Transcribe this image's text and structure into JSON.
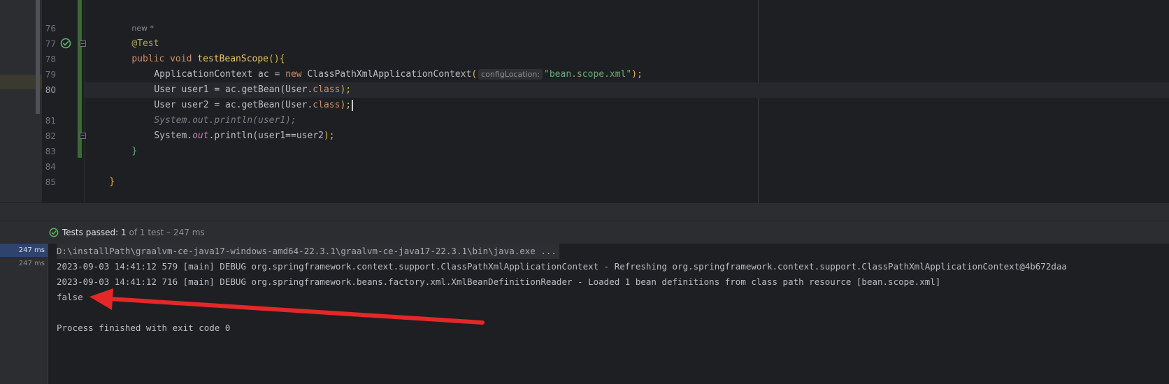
{
  "editor": {
    "usage_hint": "new *",
    "lines": [
      {
        "number": "76"
      },
      {
        "number": "77"
      },
      {
        "number": "78"
      },
      {
        "number": "79"
      },
      {
        "number": "80"
      },
      {
        "number": ""
      },
      {
        "number": "81"
      },
      {
        "number": "82"
      },
      {
        "number": "83"
      },
      {
        "number": "84"
      },
      {
        "number": "85"
      }
    ],
    "code": {
      "annotation": "@Test",
      "kw_public": "public",
      "kw_void": "void",
      "method_name": "testBeanScope",
      "method_parens": "()",
      "open_brace": "{",
      "line78_type": "ApplicationContext ac = ",
      "kw_new": "new",
      "line78_class": " ClassPathXmlApplicationContext",
      "open_paren": "(",
      "param_hint": "configLocation:",
      "string_literal": "\"bean.scope.xml\"",
      "close_paren_semi": ");",
      "line79_a": "User user1 = ac.getBean(",
      "line79_type": "User.",
      "kw_class": "class",
      "line79_close": ");",
      "line80_a": "User user2 = ac.getBean(",
      "line80_type": "User.",
      "kw_class2": "class",
      "line80_close": ");",
      "commented_line": "System.out.println(user1);",
      "line81_a": "System.",
      "line81_field": "out",
      "line81_b": ".println(",
      "line81_args": "user1==user2",
      "line81_close": ");",
      "close_brace_method": "}",
      "close_brace_class": "}"
    }
  },
  "run_panel": {
    "status_label": "Tests passed: ",
    "status_count": "1",
    "status_rest": " of 1 test – 247 ms",
    "tree_times": [
      "247 ms",
      "247 ms"
    ],
    "console_lines": [
      "D:\\installPath\\graalvm-ce-java17-windows-amd64-22.3.1\\graalvm-ce-java17-22.3.1\\bin\\java.exe ...",
      "2023-09-03 14:41:12 579 [main] DEBUG org.springframework.context.support.ClassPathXmlApplicationContext - Refreshing org.springframework.context.support.ClassPathXmlApplicationContext@4b672daa",
      "2023-09-03 14:41:12 716 [main] DEBUG org.springframework.beans.factory.xml.XmlBeanDefinitionReader - Loaded 1 bean definitions from class path resource [bean.scope.xml]",
      "false",
      "",
      "Process finished with exit code 0"
    ]
  },
  "colors": {
    "success": "#5fb865",
    "annotation_arrow": "#e52727",
    "selection": "#2e436e"
  }
}
